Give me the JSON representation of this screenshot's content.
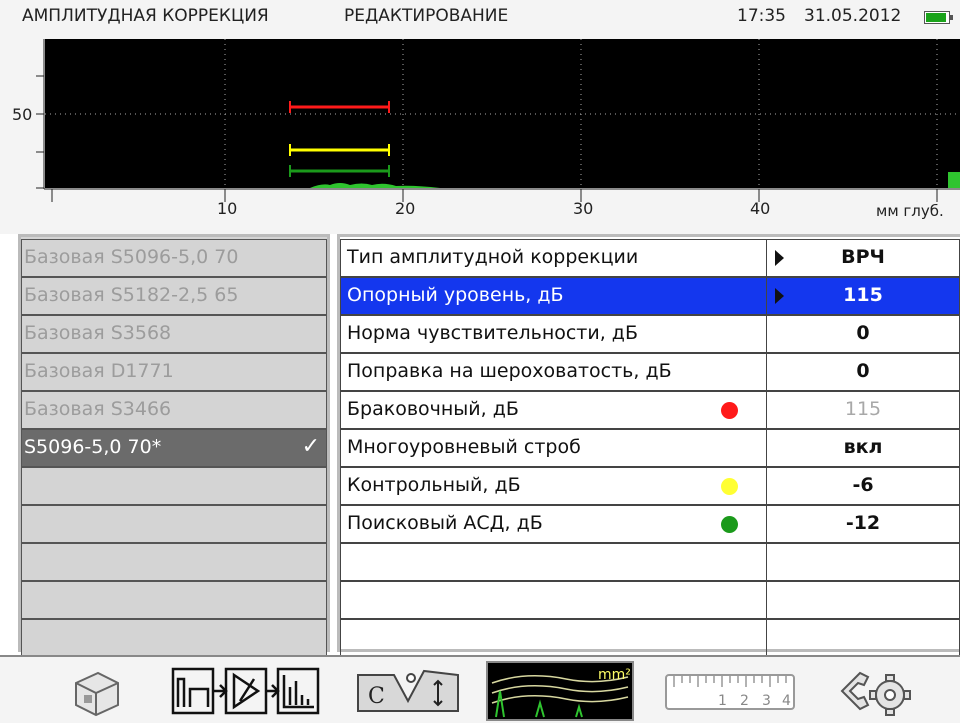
{
  "header": {
    "mode": "АМПЛИТУДНАЯ КОРРЕКЦИЯ",
    "submode": "РЕДАКТИРОВАНИЕ",
    "time": "17:35",
    "date": "31.05.2012",
    "battery_level": 0.9
  },
  "scope": {
    "y_tick_label": "50",
    "x_tick_labels": [
      "10",
      "20",
      "30",
      "40"
    ],
    "x_unit": "мм глуб.",
    "background": "#000000",
    "gates": [
      {
        "name": "reject",
        "color": "#ff1a1a"
      },
      {
        "name": "control",
        "color": "#ffff00"
      },
      {
        "name": "search",
        "color": "#1b9a1b"
      }
    ]
  },
  "list": {
    "items": [
      {
        "label": "Базовая S5096-5,0 70",
        "selected": false
      },
      {
        "label": "Базовая S5182-2,5 65",
        "selected": false
      },
      {
        "label": "Базовая S3568",
        "selected": false
      },
      {
        "label": "Базовая D1771",
        "selected": false
      },
      {
        "label": "Базовая S3466",
        "selected": false
      },
      {
        "label": "S5096-5,0 70*",
        "selected": true
      },
      {
        "label": "",
        "selected": false
      },
      {
        "label": "",
        "selected": false
      },
      {
        "label": "",
        "selected": false
      },
      {
        "label": "",
        "selected": false
      },
      {
        "label": "",
        "selected": false
      }
    ]
  },
  "params": {
    "rows": [
      {
        "label": "Тип амплитудной коррекции",
        "value": "ВРЧ",
        "arrow": true,
        "active": false,
        "dim": false,
        "dot": null
      },
      {
        "label": "Опорный уровень, дБ",
        "value": "115",
        "arrow": true,
        "active": true,
        "dim": false,
        "dot": null
      },
      {
        "label": "Норма чувствительности, дБ",
        "value": "0",
        "arrow": false,
        "active": false,
        "dim": false,
        "dot": null
      },
      {
        "label": "Поправка на шероховатость, дБ",
        "value": "0",
        "arrow": false,
        "active": false,
        "dim": false,
        "dot": null
      },
      {
        "label": "Браковочный, дБ",
        "value": "115",
        "arrow": false,
        "active": false,
        "dim": true,
        "dot": "#ff1a1a"
      },
      {
        "label": "Многоуровневый строб",
        "value": "вкл",
        "arrow": false,
        "active": false,
        "dim": false,
        "dot": null
      },
      {
        "label": "Контрольный, дБ",
        "value": "-6",
        "arrow": false,
        "active": false,
        "dim": false,
        "dot": "#ffff33"
      },
      {
        "label": "Поисковый АСД, дБ",
        "value": "-12",
        "arrow": false,
        "active": false,
        "dim": false,
        "dot": "#1b9a1b"
      },
      {
        "label": "",
        "value": "",
        "arrow": false,
        "active": false,
        "dim": false,
        "dot": null
      },
      {
        "label": "",
        "value": "",
        "arrow": false,
        "active": false,
        "dim": false,
        "dot": null
      },
      {
        "label": "",
        "value": "",
        "arrow": false,
        "active": false,
        "dim": false,
        "dot": null
      }
    ]
  },
  "toolbar": {
    "buttons": [
      {
        "icon": "probe-icon"
      },
      {
        "icon": "signal-chain-icon"
      },
      {
        "icon": "calibration-block-icon"
      },
      {
        "icon": "amplitude-curve-icon",
        "label": "mm²"
      },
      {
        "icon": "ruler-icon",
        "labels": [
          "1",
          "2",
          "3",
          "4"
        ]
      },
      {
        "icon": "settings-gears-icon"
      }
    ]
  }
}
